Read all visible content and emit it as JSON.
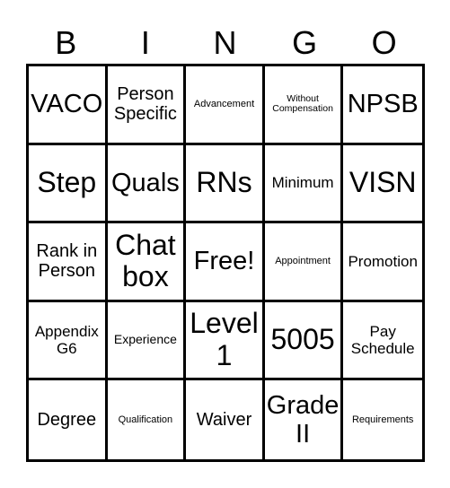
{
  "header": {
    "letters": [
      "B",
      "I",
      "N",
      "G",
      "O"
    ]
  },
  "board": {
    "rows": [
      [
        {
          "text": "VACO",
          "size": "lg"
        },
        {
          "text": "Person Specific",
          "size": "md"
        },
        {
          "text": "Advancement",
          "size": "xs"
        },
        {
          "text": "Without Compensation",
          "size": "xxs"
        },
        {
          "text": "NPSB",
          "size": "lg"
        }
      ],
      [
        {
          "text": "Step",
          "size": "xl"
        },
        {
          "text": "Quals",
          "size": "lg"
        },
        {
          "text": "RNs",
          "size": "xl"
        },
        {
          "text": "Minimum",
          "size": "ms"
        },
        {
          "text": "VISN",
          "size": "xl"
        }
      ],
      [
        {
          "text": "Rank in Person",
          "size": "md"
        },
        {
          "text": "Chat box",
          "size": "xl"
        },
        {
          "text": "Free!",
          "size": "lg"
        },
        {
          "text": "Appointment",
          "size": "xs"
        },
        {
          "text": "Promotion",
          "size": "ms"
        }
      ],
      [
        {
          "text": "Appendix G6",
          "size": "ms"
        },
        {
          "text": "Experience",
          "size": "sm"
        },
        {
          "text": "Level 1",
          "size": "xl"
        },
        {
          "text": "5005",
          "size": "xl"
        },
        {
          "text": "Pay Schedule",
          "size": "ms"
        }
      ],
      [
        {
          "text": "Degree",
          "size": "md"
        },
        {
          "text": "Qualification",
          "size": "xs"
        },
        {
          "text": "Waiver",
          "size": "md"
        },
        {
          "text": "Grade II",
          "size": "lg"
        },
        {
          "text": "Requirements",
          "size": "xs"
        }
      ]
    ]
  }
}
